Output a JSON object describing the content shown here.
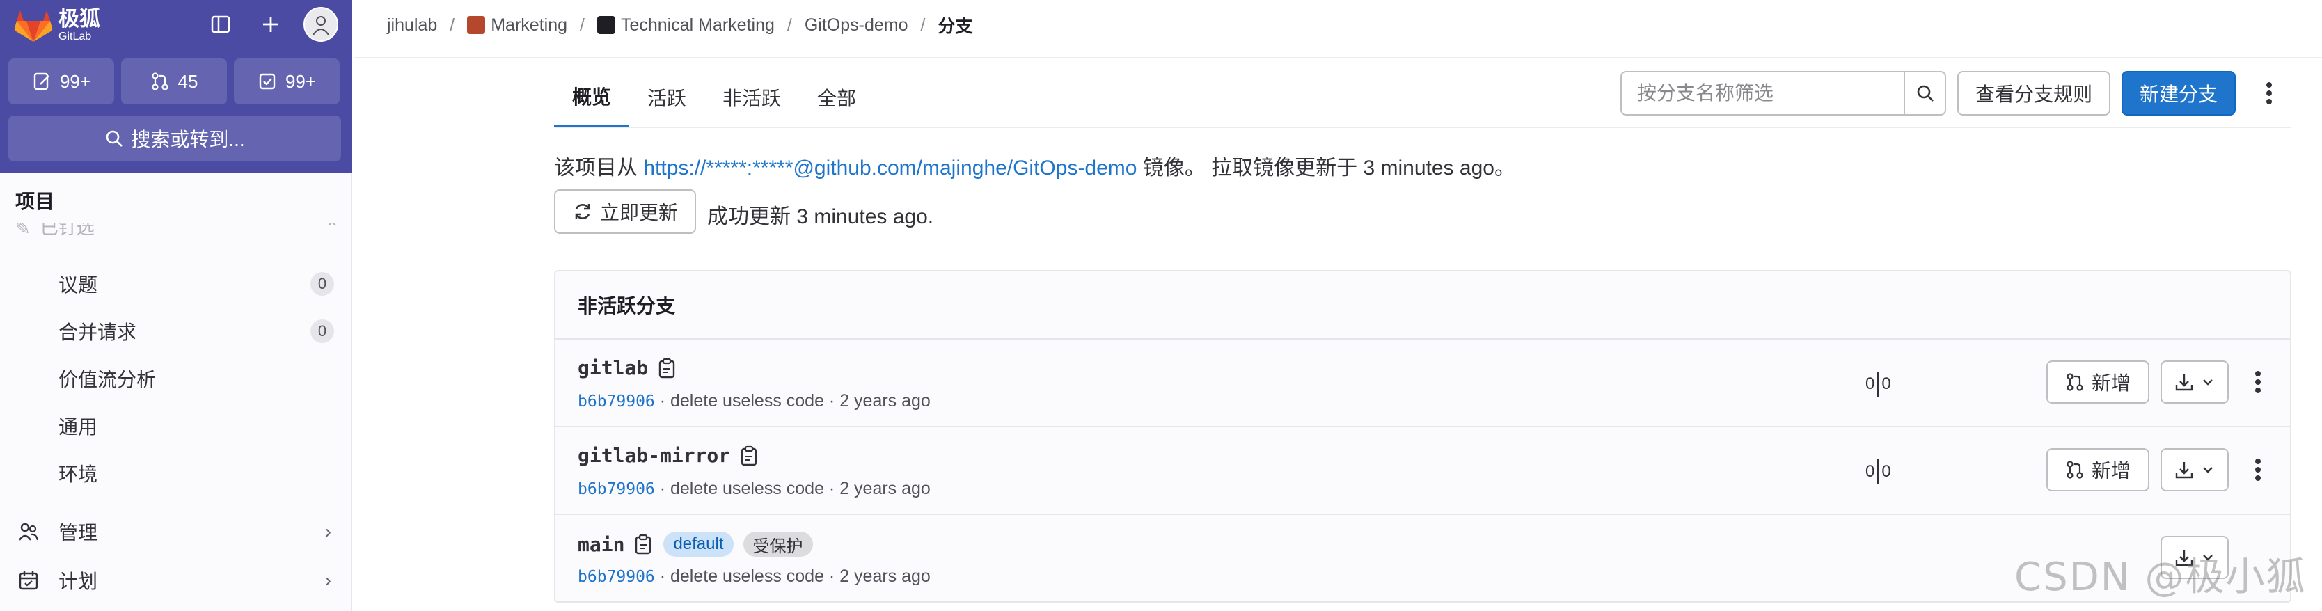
{
  "sidebar": {
    "logo_cn": "极狐",
    "logo_en": "GitLab",
    "counters": [
      {
        "icon": "issues-icon",
        "value": "99+"
      },
      {
        "icon": "merge-request-icon",
        "value": "45"
      },
      {
        "icon": "todo-icon",
        "value": "99+"
      }
    ],
    "search_label": "搜索或转到...",
    "section_title": "项目",
    "faded_item": "已钉选",
    "items": [
      {
        "label": "议题",
        "count": "0"
      },
      {
        "label": "合并请求",
        "count": "0"
      },
      {
        "label": "价值流分析"
      },
      {
        "label": "通用"
      },
      {
        "label": "环境"
      }
    ],
    "groups": [
      {
        "label": "管理",
        "icon": "users-icon"
      },
      {
        "label": "计划",
        "icon": "calendar-icon"
      }
    ]
  },
  "breadcrumb": {
    "items": [
      "jihulab",
      "Marketing",
      "Technical Marketing",
      "GitOps-demo",
      "分支"
    ]
  },
  "tabs": [
    "概览",
    "活跃",
    "非活跃",
    "全部"
  ],
  "filter": {
    "placeholder": "按分支名称筛选"
  },
  "buttons": {
    "branch_rules": "查看分支规则",
    "new_branch": "新建分支",
    "update_now": "立即更新",
    "new": "新增"
  },
  "mirror": {
    "prefix": "该项目从",
    "url": "https://*****:*****@github.com/majinghe/GitOps-demo",
    "suffix": "镜像。 拉取镜像更新于 3 minutes ago。",
    "status": "成功更新 3 minutes ago."
  },
  "card": {
    "title": "非活跃分支",
    "branches": [
      {
        "name": "gitlab",
        "sha": "b6b79906",
        "message": " · delete useless code · 2 years ago",
        "behind": "0",
        "ahead": "0"
      },
      {
        "name": "gitlab-mirror",
        "sha": "b6b79906",
        "message": " · delete useless code · 2 years ago",
        "behind": "0",
        "ahead": "0"
      },
      {
        "name": "main",
        "sha": "b6b79906",
        "message": " · delete useless code · 2 years ago",
        "badges": [
          "default",
          "受保护"
        ]
      }
    ]
  },
  "watermark": "CSDN @极小狐",
  "colors": {
    "brand": "#4b4ba3",
    "accent": "#1f75cb"
  }
}
